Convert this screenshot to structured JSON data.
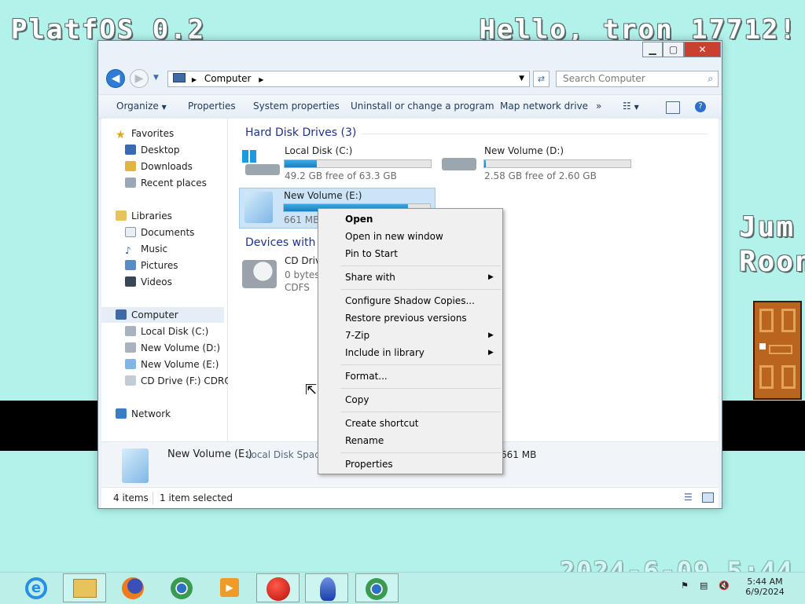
{
  "desktop": {
    "title": "PlatfOS 0.2",
    "greeting": "Hello, tron 17712!",
    "jump_line1": "Jum",
    "jump_line2": "Roon",
    "clock_big": "2024-6-09 5:44"
  },
  "window": {
    "address": {
      "root_icon": "computer-icon",
      "crumb": "Computer"
    },
    "search_placeholder": "Search Computer",
    "toolbar": {
      "organize": "Organize",
      "properties": "Properties",
      "system_properties": "System properties",
      "uninstall": "Uninstall or change a program",
      "map_drive": "Map network drive",
      "more": "»"
    },
    "sidebar": {
      "favorites": "Favorites",
      "fav_items": [
        "Desktop",
        "Downloads",
        "Recent places"
      ],
      "libraries": "Libraries",
      "lib_items": [
        "Documents",
        "Music",
        "Pictures",
        "Videos"
      ],
      "computer": "Computer",
      "comp_items": [
        "Local Disk (C:)",
        "New Volume (D:)",
        "New Volume (E:)",
        "CD Drive (F:) CDROM"
      ],
      "network": "Network"
    },
    "groups": {
      "hdd": "Hard Disk Drives (3)",
      "devices": "Devices with Removable Storage (1)"
    },
    "drives": [
      {
        "name": "Local Disk (C:)",
        "free": "49.2 GB free of 63.3 GB",
        "used_fraction": 0.22
      },
      {
        "name": "New Volume (D:)",
        "free": "2.58 GB free of 2.60 GB",
        "used_fraction": 0.01
      },
      {
        "name": "New Volume (E:)",
        "free": "661 MB",
        "used_fraction": 0.85
      }
    ],
    "cd_drive": {
      "name": "CD Drive (F:) CDROM",
      "free": "0 bytes free of",
      "fs": "CDFS"
    },
    "details": {
      "name": "New Volume (E:)",
      "type": "Local Disk Space",
      "size": "661 MB"
    },
    "status": {
      "items": "4 items",
      "selected": "1 item selected"
    }
  },
  "context_menu": {
    "open": "Open",
    "open_new_window": "Open in new window",
    "pin_to_start": "Pin to Start",
    "share_with": "Share with",
    "configure_shadow": "Configure Shadow Copies...",
    "restore_versions": "Restore previous versions",
    "seven_zip": "7-Zip",
    "include_library": "Include in library",
    "format": "Format...",
    "copy": "Copy",
    "create_shortcut": "Create shortcut",
    "rename": "Rename",
    "properties": "Properties"
  },
  "taskbar": {
    "apps": [
      "ie-icon",
      "explorer-icon",
      "firefox-icon",
      "chrome-icon",
      "media-player-icon",
      "record-icon",
      "app-icon",
      "browser-icon"
    ],
    "time": "5:44 AM",
    "date": "6/9/2024"
  },
  "colors": {
    "desktop_bg": "#b1f2eb",
    "accent": "#2f7cd6",
    "close_red": "#c9402f"
  }
}
